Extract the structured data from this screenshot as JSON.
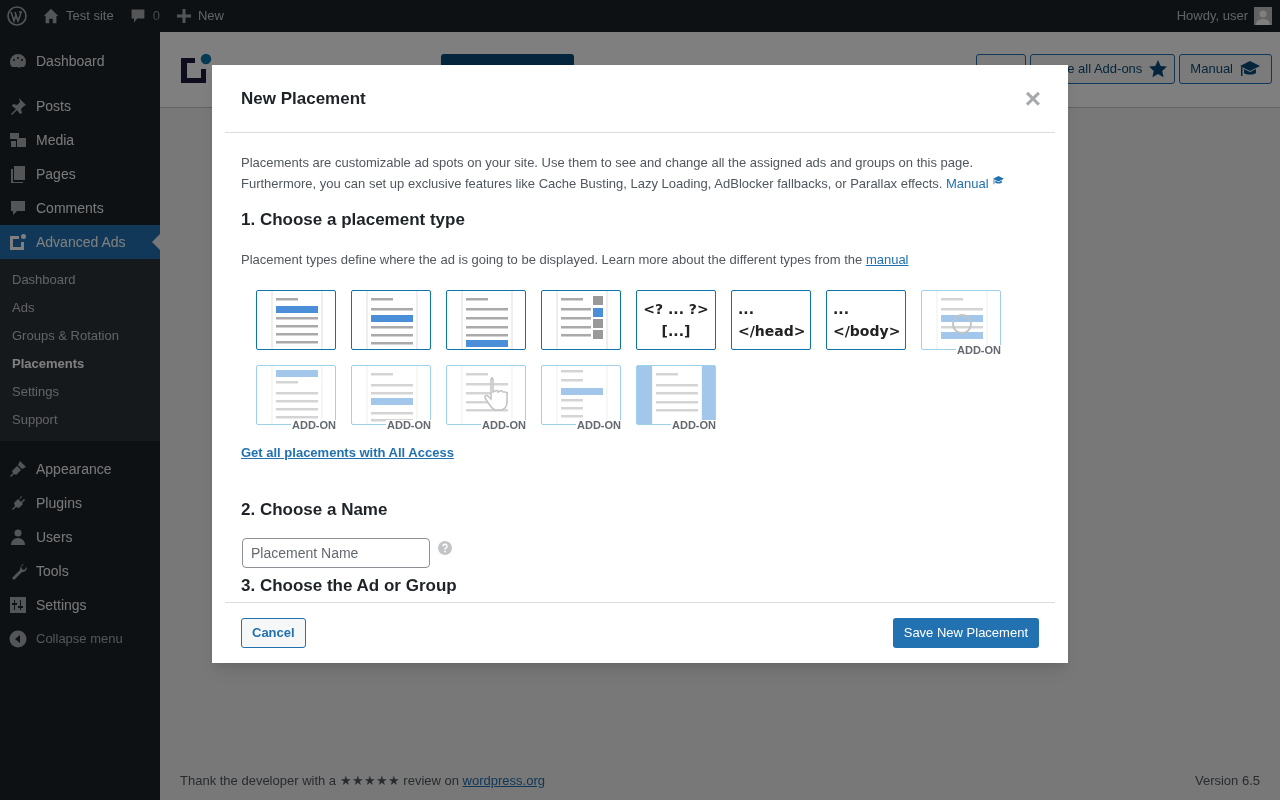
{
  "admin_bar": {
    "site": "Test site",
    "comments": "0",
    "new": "New",
    "greeting": "Howdy, user"
  },
  "sidebar": {
    "items": [
      {
        "label": "Dashboard",
        "selected": false
      },
      {
        "label": "Posts",
        "selected": false
      },
      {
        "label": "Media",
        "selected": false
      },
      {
        "label": "Pages",
        "selected": false
      },
      {
        "label": "Comments",
        "selected": false
      },
      {
        "label": "Advanced Ads",
        "selected": true,
        "children": [
          {
            "label": "Dashboard",
            "selected": false
          },
          {
            "label": "Ads",
            "selected": false
          },
          {
            "label": "Groups & Rotation",
            "selected": false
          },
          {
            "label": "Placements",
            "selected": true
          },
          {
            "label": "Settings",
            "selected": false
          },
          {
            "label": "Support",
            "selected": false
          }
        ]
      },
      {
        "label": "Appearance",
        "selected": false
      },
      {
        "label": "Plugins",
        "selected": false
      },
      {
        "label": "Users",
        "selected": false
      },
      {
        "label": "Tools",
        "selected": false
      },
      {
        "label": "Settings",
        "selected": false
      }
    ],
    "collapse": "Collapse menu"
  },
  "page_header": {
    "buttons": [
      {
        "label": "e all Add-ons"
      },
      {
        "label": "Manual"
      }
    ]
  },
  "footer": {
    "text": "Thank the developer with a ★★★★★ review on",
    "link": "wordpress.org",
    "version": "Version 6.5"
  },
  "modal": {
    "title": "New Placement",
    "close": "×",
    "intro": "Placements are customizable ad spots on your site. Use them to see and change all the assigned ads and groups on this page. Furthermore, you can set up exclusive features like Cache Busting, Lazy Loading, AdBlocker fallbacks, or Parallax effects.",
    "intro_link": "Manual",
    "step1": {
      "heading": "1. Choose a placement type",
      "text": "Placement types define where the ad is going to be displayed. Learn more about the different types from the",
      "link": "manual",
      "types": [
        {
          "kind": "before-content",
          "disabled": false
        },
        {
          "kind": "content",
          "disabled": false
        },
        {
          "kind": "after-content",
          "disabled": false
        },
        {
          "kind": "sidebar",
          "disabled": false
        },
        {
          "kind": "code",
          "lines": [
            "<? ... ?>",
            "[...]"
          ],
          "disabled": false
        },
        {
          "kind": "code",
          "lines": [
            "...",
            "</head>"
          ],
          "disabled": false
        },
        {
          "kind": "code",
          "lines": [
            "...",
            "</body>"
          ],
          "disabled": false
        },
        {
          "kind": "rotation",
          "disabled": true,
          "badge": "ADD-ON"
        },
        {
          "kind": "top",
          "disabled": true,
          "badge": "ADD-ON"
        },
        {
          "kind": "random",
          "disabled": true,
          "badge": "ADD-ON"
        },
        {
          "kind": "click",
          "disabled": true,
          "badge": "ADD-ON"
        },
        {
          "kind": "block",
          "disabled": true,
          "badge": "ADD-ON"
        },
        {
          "kind": "background",
          "disabled": true,
          "badge": "ADD-ON"
        }
      ],
      "upgrade_link": "Get all placements with All Access"
    },
    "step2": {
      "heading": "2. Choose a Name",
      "placeholder": "Placement Name"
    },
    "step3": {
      "heading": "3. Choose the Ad or Group"
    },
    "cancel": "Cancel",
    "save": "Save New Placement"
  }
}
